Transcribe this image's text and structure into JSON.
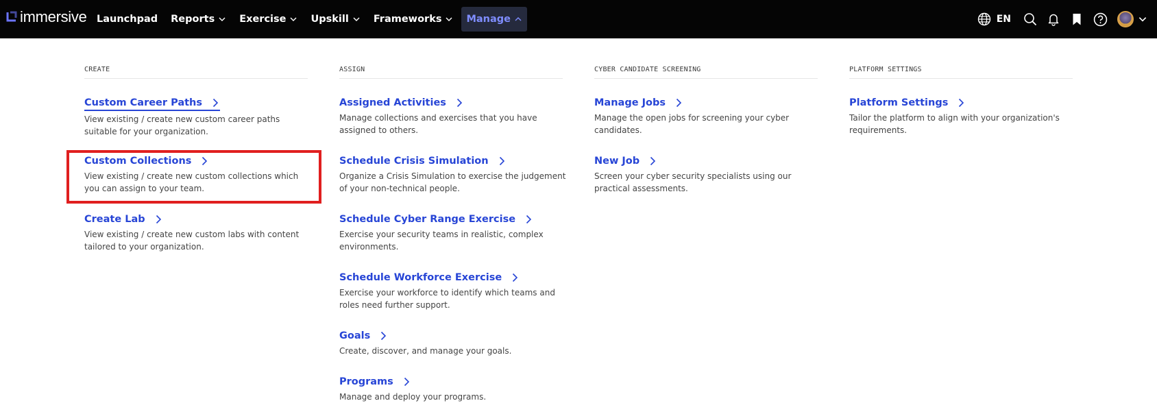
{
  "brand": {
    "name": "immersive"
  },
  "nav": {
    "items": [
      {
        "label": "Launchpad",
        "has_dropdown": false
      },
      {
        "label": "Reports",
        "has_dropdown": true
      },
      {
        "label": "Exercise",
        "has_dropdown": true
      },
      {
        "label": "Upskill",
        "has_dropdown": true
      },
      {
        "label": "Frameworks",
        "has_dropdown": true
      },
      {
        "label": "Manage",
        "has_dropdown": true,
        "active": true
      }
    ]
  },
  "tools": {
    "language": "EN",
    "icons": [
      "globe-icon",
      "search-icon",
      "bell-icon",
      "bookmark-icon",
      "help-icon",
      "avatar",
      "chevron-down-icon"
    ]
  },
  "menu": {
    "columns": [
      {
        "heading": "CREATE",
        "entries": [
          {
            "title": "Custom Career Paths",
            "desc": "View existing / create new custom career paths suitable for your organization."
          },
          {
            "title": "Custom Collections",
            "desc": "View existing / create new custom collections which you can assign to your team."
          },
          {
            "title": "Create Lab",
            "desc": "View existing / create new custom labs with content tailored to your organization."
          }
        ]
      },
      {
        "heading": "ASSIGN",
        "entries": [
          {
            "title": "Assigned Activities",
            "desc": "Manage collections and exercises that you have assigned to others."
          },
          {
            "title": "Schedule Crisis Simulation",
            "desc": "Organize a Crisis Simulation to exercise the judgement of your non-technical people."
          },
          {
            "title": "Schedule Cyber Range Exercise",
            "desc": "Exercise your security teams in realistic, complex environments."
          },
          {
            "title": "Schedule Workforce Exercise",
            "desc": "Exercise your workforce to identify which teams and roles need further support."
          },
          {
            "title": "Goals",
            "desc": "Create, discover, and manage your goals."
          },
          {
            "title": "Programs",
            "desc": "Manage and deploy your programs."
          }
        ]
      },
      {
        "heading": "CYBER CANDIDATE SCREENING",
        "entries": [
          {
            "title": "Manage Jobs",
            "desc": "Manage the open jobs for screening your cyber candidates."
          },
          {
            "title": "New Job",
            "desc": "Screen your cyber security specialists using our practical assessments."
          }
        ]
      },
      {
        "heading": "PLATFORM SETTINGS",
        "entries": [
          {
            "title": "Platform Settings",
            "desc": "Tailor the platform to align with your organization's requirements."
          }
        ]
      }
    ]
  },
  "colors": {
    "topbar": "#050505",
    "link": "#2745d6",
    "active_nav_text": "#7f8dff",
    "highlight_box": "#e01f1f"
  }
}
